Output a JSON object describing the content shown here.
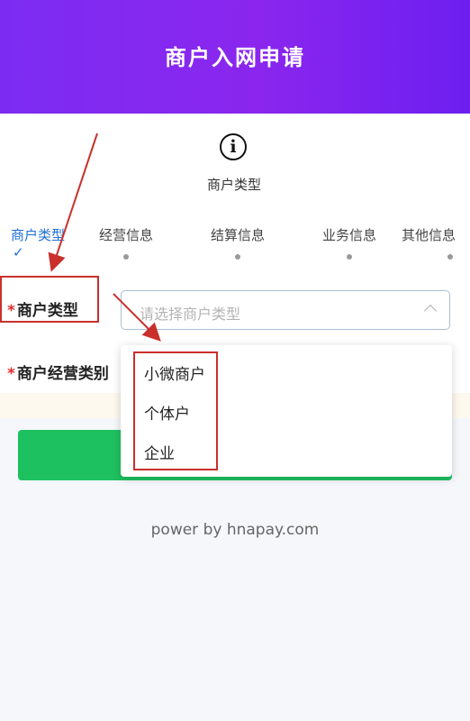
{
  "header": {
    "title": "商户入网申请"
  },
  "current_step": {
    "icon": "info-circle-icon",
    "icon_glyph": "i",
    "label": "商户类型"
  },
  "steps": [
    {
      "label": "商户类型",
      "state": "active",
      "marker": "✓"
    },
    {
      "label": "经营信息",
      "state": "pending"
    },
    {
      "label": "结算信息",
      "state": "pending"
    },
    {
      "label": "业务信息",
      "state": "pending"
    },
    {
      "label": "其他信息",
      "state": "pending"
    }
  ],
  "form": {
    "merchant_type": {
      "required_mark": "*",
      "label": "商户类型",
      "placeholder": "请选择商户类型"
    },
    "business_category": {
      "required_mark": "*",
      "label": "商户经营类别"
    }
  },
  "dropdown": {
    "options": [
      "小微商户",
      "个体户",
      "企业"
    ]
  },
  "footer": {
    "text": "power by hnapay.com"
  },
  "colors": {
    "header_gradient_start": "#7c2cf2",
    "header_gradient_end": "#6d1ff0",
    "active_step": "#1d6fd8",
    "required_mark": "#e02a2a",
    "submit_button": "#1ec160",
    "annotation": "#c9302c"
  }
}
